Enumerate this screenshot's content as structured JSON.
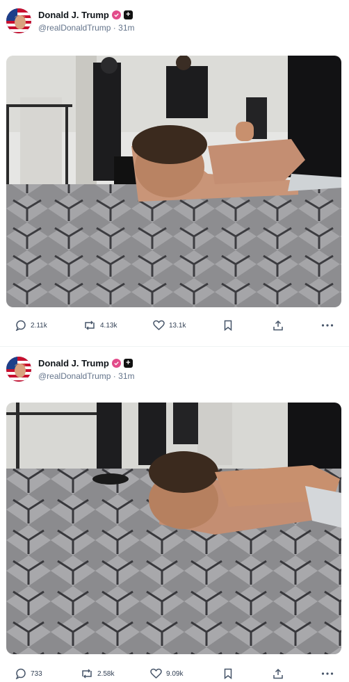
{
  "posts": [
    {
      "author": {
        "name": "Donald J. Trump",
        "handle": "@realDonaldTrump",
        "time": "31m"
      },
      "stats": {
        "replies": "2.11k",
        "reposts": "4.13k",
        "likes": "13.1k"
      }
    },
    {
      "author": {
        "name": "Donald J. Trump",
        "handle": "@realDonaldTrump",
        "time": "31m"
      },
      "stats": {
        "replies": "733",
        "reposts": "2.58k",
        "likes": "9.09k"
      }
    }
  ],
  "icons": {
    "reply": "reply-icon",
    "repost": "repost-icon",
    "like": "heart-icon",
    "bookmark": "bookmark-icon",
    "share": "share-icon",
    "more": "more-icon",
    "verified": "verified-badge-icon",
    "plus": "plus-badge-icon"
  },
  "colors": {
    "verified": "#e24b8a",
    "muted": "#64748b",
    "text": "#0f1419"
  }
}
